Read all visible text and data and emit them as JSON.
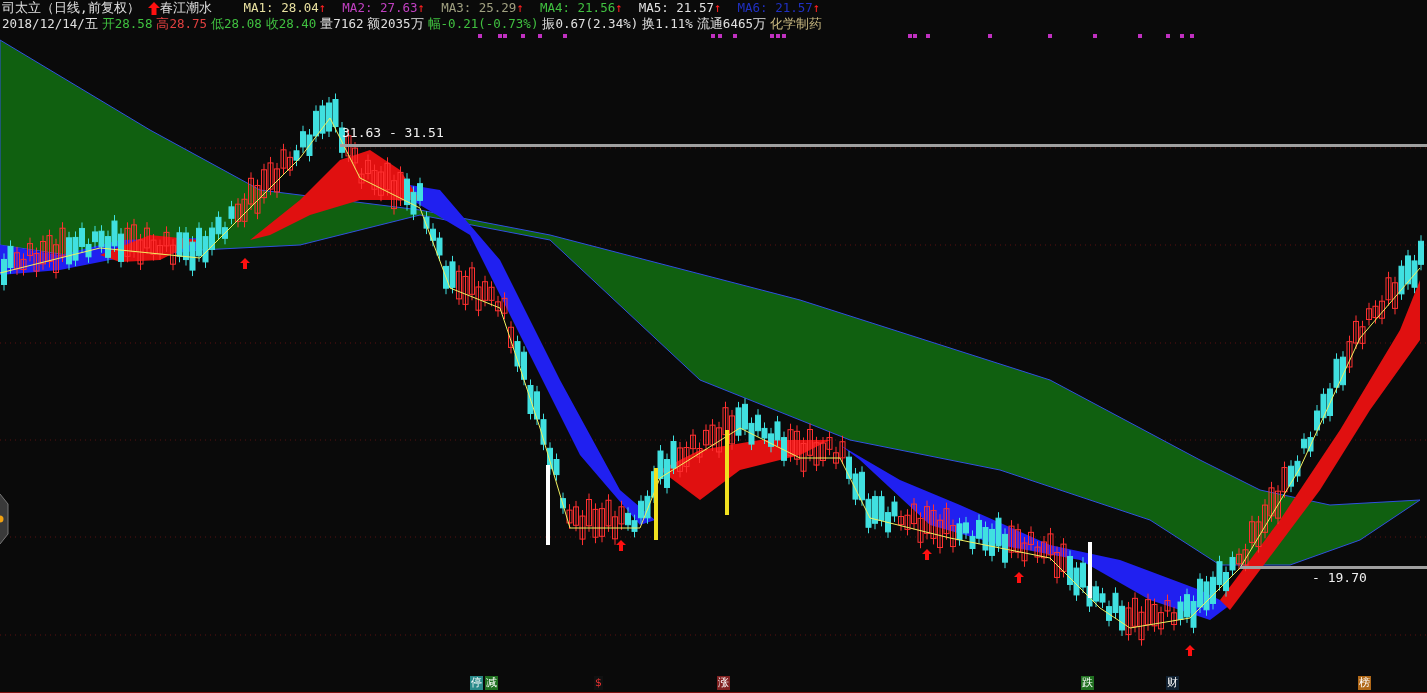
{
  "title": "司太立（日线,前复权）",
  "indicator": {
    "name": "春江潮水"
  },
  "ma_lines": [
    {
      "label": "MA1: 28.04",
      "arrow": "↑",
      "color": "#e8e0a0"
    },
    {
      "label": "MA2: 27.63",
      "arrow": "↑",
      "color": "#c040c0"
    },
    {
      "label": "MA3: 25.29",
      "arrow": "↑",
      "color": "#a0a080"
    },
    {
      "label": "MA4: 21.56",
      "arrow": "↑",
      "color": "#40c040"
    },
    {
      "label": "MA5: 21.57",
      "arrow": "↑",
      "color": "#e0e0e0"
    },
    {
      "label": "MA6: 21.57",
      "arrow": "↑",
      "color": "#2030c0"
    }
  ],
  "quote": [
    {
      "text": "2018/12/14/五",
      "color": "#e0e0e0"
    },
    {
      "text": "开28.58",
      "color": "#40c040"
    },
    {
      "text": "高28.75",
      "color": "#e04040"
    },
    {
      "text": "低28.08",
      "color": "#40c040"
    },
    {
      "text": "收28.40",
      "color": "#40c040"
    },
    {
      "text": "量7162",
      "color": "#e0e0e0"
    },
    {
      "text": "额2035万",
      "color": "#e0e0e0"
    },
    {
      "text": "幅-0.21(-0.73%)",
      "color": "#40c040"
    },
    {
      "text": "振0.67(2.34%)",
      "color": "#e0e0e0"
    },
    {
      "text": "换1.11%",
      "color": "#e0e0e0"
    },
    {
      "text": "流通6465万",
      "color": "#e0e0e0"
    },
    {
      "text": "化学制药",
      "color": "#c8b880"
    }
  ],
  "price_levels": [
    {
      "label": "31.63 - 31.51"
    },
    {
      "label": "- 19.70"
    }
  ],
  "event_markers": [
    {
      "text": "停",
      "color": "#2a8a8a"
    },
    {
      "text": "减",
      "color": "#207020"
    },
    {
      "text": "$",
      "color": "#101010"
    },
    {
      "text": "涨",
      "color": "#802020"
    },
    {
      "text": "跌",
      "color": "#207020"
    },
    {
      "text": "财",
      "color": "#102030"
    },
    {
      "text": "榜",
      "color": "#b06818"
    }
  ]
}
